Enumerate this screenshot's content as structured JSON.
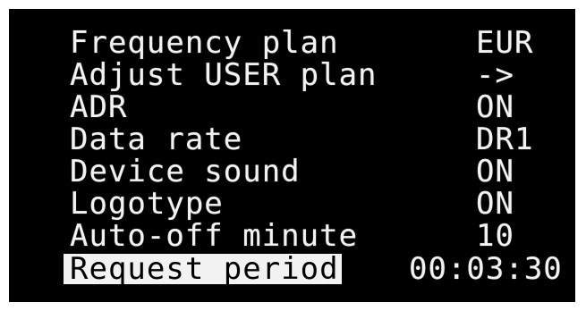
{
  "menu": {
    "items": [
      {
        "label": "Frequency plan",
        "value": "EUR"
      },
      {
        "label": "Adjust USER plan",
        "value": "->"
      },
      {
        "label": "ADR",
        "value": "ON"
      },
      {
        "label": "Data rate",
        "value": "DR1"
      },
      {
        "label": "Device sound",
        "value": "ON"
      },
      {
        "label": "Logotype",
        "value": "ON"
      },
      {
        "label": "Auto-off minute",
        "value": "10"
      },
      {
        "label": "Request period",
        "value": "00:03:30"
      }
    ],
    "selected_index": 7
  },
  "colors": {
    "screen_background": "#000000",
    "text": "#f2f2f2",
    "selection_background": "#f2f2f2",
    "selection_text": "#000000"
  }
}
